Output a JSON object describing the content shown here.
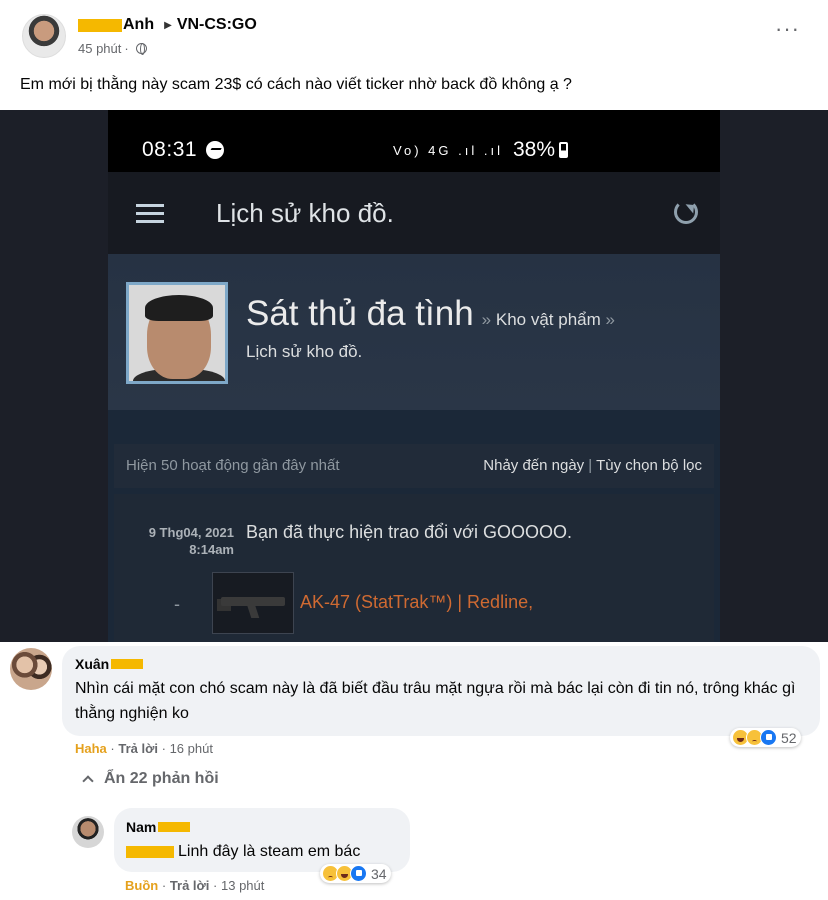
{
  "post": {
    "author": "Anh",
    "group": "VN-CS:GO",
    "time": "45 phút",
    "text": "Em mới bị thằng này scam 23$ có cách nào viết ticker nhờ back đồ không ạ ?"
  },
  "screenshot": {
    "status_time": "08:31",
    "status_icons": "Vo) 4G .ıl .ıl",
    "status_battery": "38%",
    "app_title": "Lịch sử kho đồ.",
    "profile_name": "Sát thủ đa tình",
    "breadcrumb_sep": "»",
    "breadcrumb_link": "Kho vật phẩm",
    "profile_sub": "Lịch sử kho đồ.",
    "filter_count": "Hiện 50 hoạt động gần đây nhất",
    "jump_to_date": "Nhảy đến ngày",
    "filter_sep": "|",
    "filter_options": "Tùy chọn bộ lọc",
    "history_date": "9 Thg04, 2021",
    "history_time": "8:14am",
    "history_desc_prefix": "Bạn đã thực hiện trao đổi với",
    "history_desc_user": "GOOOOO.",
    "item_dash": "-",
    "item_name": "AK-47 (StatTrak™) | Redline,"
  },
  "comments": [
    {
      "name": "Xuân",
      "text": "Nhìn cái mặt con chó scam này là đã biết đầu trâu mặt ngựa rồi mà bác lại còn đi tin nó, trông khác gì thằng nghiện ko",
      "reaction_label": "Haha",
      "reply_label": "Trả lời",
      "time": "16 phút",
      "reaction_count": "52"
    },
    {
      "name": "Nam",
      "text": "Linh đây là steam em bác",
      "reaction_label": "Buồn",
      "reply_label": "Trả lời",
      "time": "13 phút",
      "reaction_count": "34"
    }
  ],
  "show_replies": "Ẩn 22 phản hồi",
  "separator": "·",
  "colors": {
    "steam_bg": "#1b2838",
    "item_name": "#cf6a32",
    "name_redact": "#f5b800",
    "bubble": "#f0f2f5"
  }
}
